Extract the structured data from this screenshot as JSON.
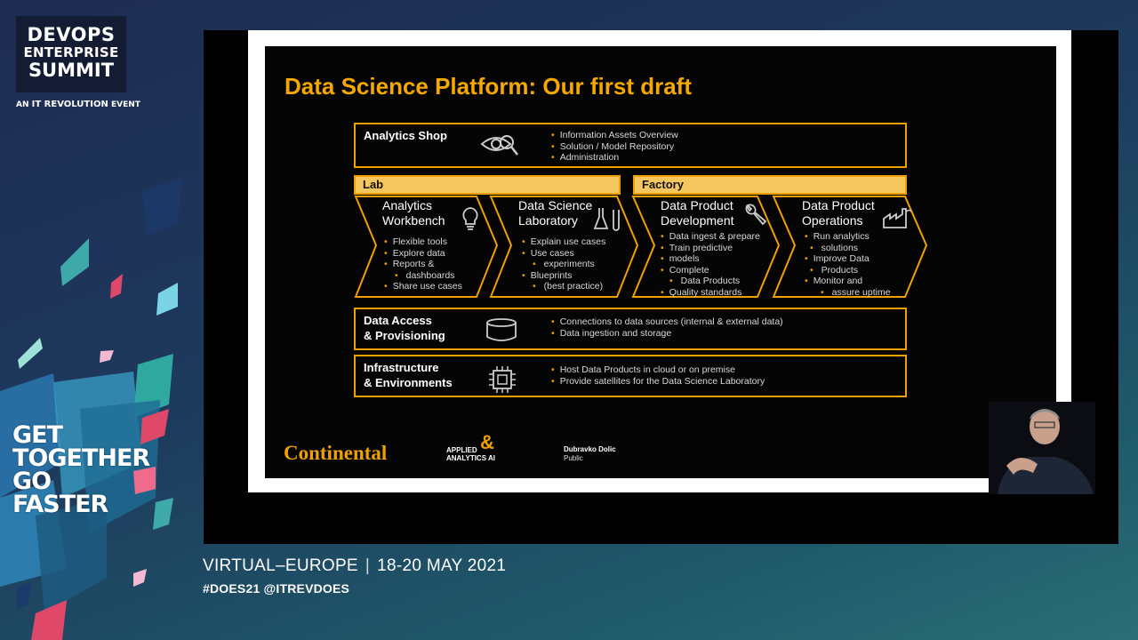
{
  "branding": {
    "line1": "DEVOPS",
    "line2": "ENTERPRISE",
    "line3": "SUMMIT",
    "sub_prefix": "AN",
    "sub_brand": "IT REVOLUTION",
    "sub_suffix": "EVENT",
    "slogan": [
      "GET",
      "TOGETHER",
      "GO",
      "FASTER"
    ]
  },
  "slide": {
    "title": "Data Science Platform: Our first draft",
    "analytics_shop": {
      "title": "Analytics Shop",
      "icon": "eye-icon",
      "bullets": [
        "Information Assets Overview",
        "Solution / Model Repository",
        "Administration"
      ]
    },
    "lab_label": "Lab",
    "factory_label": "Factory",
    "chevrons": [
      {
        "title": [
          "Analytics",
          "Workbench"
        ],
        "icon": "lightbulb-icon",
        "bullets": [
          "Flexible tools",
          "Explore data",
          "Reports &",
          "  dashboards",
          "Share use cases"
        ]
      },
      {
        "title": [
          "Data Science",
          "Laboratory"
        ],
        "icon": "flask-icon",
        "bullets": [
          "Explain use cases",
          "Use cases",
          "  experiments",
          "Blueprints",
          "  (best practice)"
        ]
      },
      {
        "title": [
          "Data Product",
          "Development"
        ],
        "icon": "wrench-icon",
        "bullets": [
          "Data ingest & prepare",
          "Train predictive",
          "models",
          "Complete",
          "  Data Products",
          "Quality standards"
        ]
      },
      {
        "title": [
          "Data Product",
          "Operations"
        ],
        "icon": "factory-icon",
        "bullets": [
          "Run analytics",
          "  solutions",
          "Improve Data",
          "  Products",
          "Monitor and",
          "  assure uptime"
        ]
      }
    ],
    "data_access": {
      "title": [
        "Data Access",
        "& Provisioning"
      ],
      "icon": "database-icon",
      "bullets": [
        "Connections to data sources (internal & external data)",
        "Data ingestion and storage"
      ]
    },
    "infrastructure": {
      "title": [
        "Infrastructure",
        "& Environments"
      ],
      "icon": "chip-icon",
      "bullets": [
        "Host Data Products in cloud or on premise",
        "Provide satellites for the Data Science Laboratory"
      ]
    },
    "footer": {
      "logo": "Continental",
      "applied_line1": "APPLIED",
      "applied_line2": "ANALYTICS",
      "applied_ai": "AI",
      "presenter": "Dubravko Dolic",
      "classification": "Public"
    }
  },
  "event": {
    "name": "VIRTUAL–EUROPE",
    "dates": "18-20 MAY 2021",
    "hashtags": "#DOES21 @ITREVDOES"
  },
  "colors": {
    "accent": "#f0a000",
    "band": "#f6c75e",
    "background": "#1e2b52"
  }
}
